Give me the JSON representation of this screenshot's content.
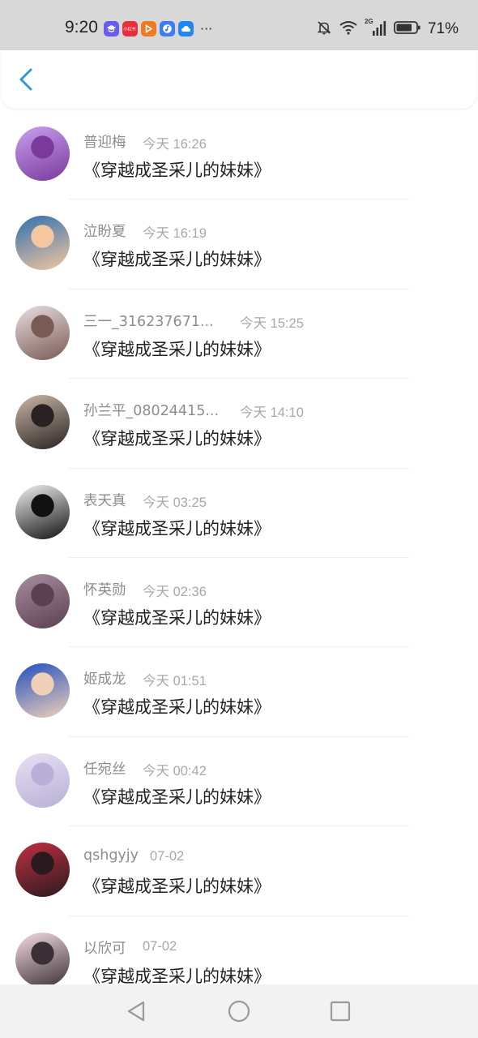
{
  "status_bar": {
    "time": "9:20",
    "apps": [
      {
        "icon": "graduation-cap-app-icon",
        "color": "#6a5cf0",
        "text": ""
      },
      {
        "icon": "red-app-icon",
        "color": "#e8303a",
        "text": "小红书"
      },
      {
        "icon": "play-app-icon",
        "color": "#f07a22",
        "text": ""
      },
      {
        "icon": "music-app-icon",
        "color": "#3f7cf2",
        "text": ""
      },
      {
        "icon": "cloud-app-icon",
        "color": "#1f86f5",
        "text": ""
      }
    ],
    "more": "···",
    "battery": "71%",
    "network": "2G"
  },
  "header": {
    "back_icon": "chevron-left-icon",
    "accent": "#2f9bdf"
  },
  "messages": [
    {
      "name": "普迎梅",
      "time": "今天 16:26",
      "text": "《穿越成圣采儿的妹妹》",
      "avatar_colors": [
        "#c8a0f0",
        "#7a3a9a"
      ]
    },
    {
      "name": "泣盼夏",
      "time": "今天 16:19",
      "text": "《穿越成圣采儿的妹妹》",
      "avatar_colors": [
        "#2f6fb0",
        "#f4c7a0"
      ]
    },
    {
      "name": "三一_316237671...",
      "time": "今天 15:25",
      "text": "《穿越成圣采儿的妹妹》",
      "avatar_colors": [
        "#e9dfe0",
        "#7a5a55"
      ]
    },
    {
      "name": "孙兰平_08024415...",
      "time": "今天 14:10",
      "text": "《穿越成圣采儿的妹妹》",
      "avatar_colors": [
        "#c9b8a6",
        "#2a2222"
      ]
    },
    {
      "name": "表天真",
      "time": "今天 03:25",
      "text": "《穿越成圣采儿的妹妹》",
      "avatar_colors": [
        "#f2f2f2",
        "#111111"
      ]
    },
    {
      "name": "怀英勋",
      "time": "今天 02:36",
      "text": "《穿越成圣采儿的妹妹》",
      "avatar_colors": [
        "#a88ea0",
        "#5a4050"
      ]
    },
    {
      "name": "姬成龙",
      "time": "今天 01:51",
      "text": "《穿越成圣采儿的妹妹》",
      "avatar_colors": [
        "#1f4fc0",
        "#f1d0b8"
      ]
    },
    {
      "name": "任宛丝",
      "time": "今天 00:42",
      "text": "《穿越成圣采儿的妹妹》",
      "avatar_colors": [
        "#e8e0f0",
        "#b8b0d8"
      ]
    },
    {
      "name": "qshgyjy",
      "time": "07-02",
      "text": "《穿越成圣采儿的妹妹》",
      "avatar_colors": [
        "#c03040",
        "#2a1a20"
      ]
    },
    {
      "name": "以欣可",
      "time": "07-02",
      "text": "《穿越成圣采儿的妹妹》",
      "avatar_colors": [
        "#f6dde2",
        "#3a3036"
      ]
    }
  ],
  "nav_bar": {
    "buttons": [
      "back-triangle-icon",
      "home-circle-icon",
      "recents-square-icon"
    ]
  }
}
